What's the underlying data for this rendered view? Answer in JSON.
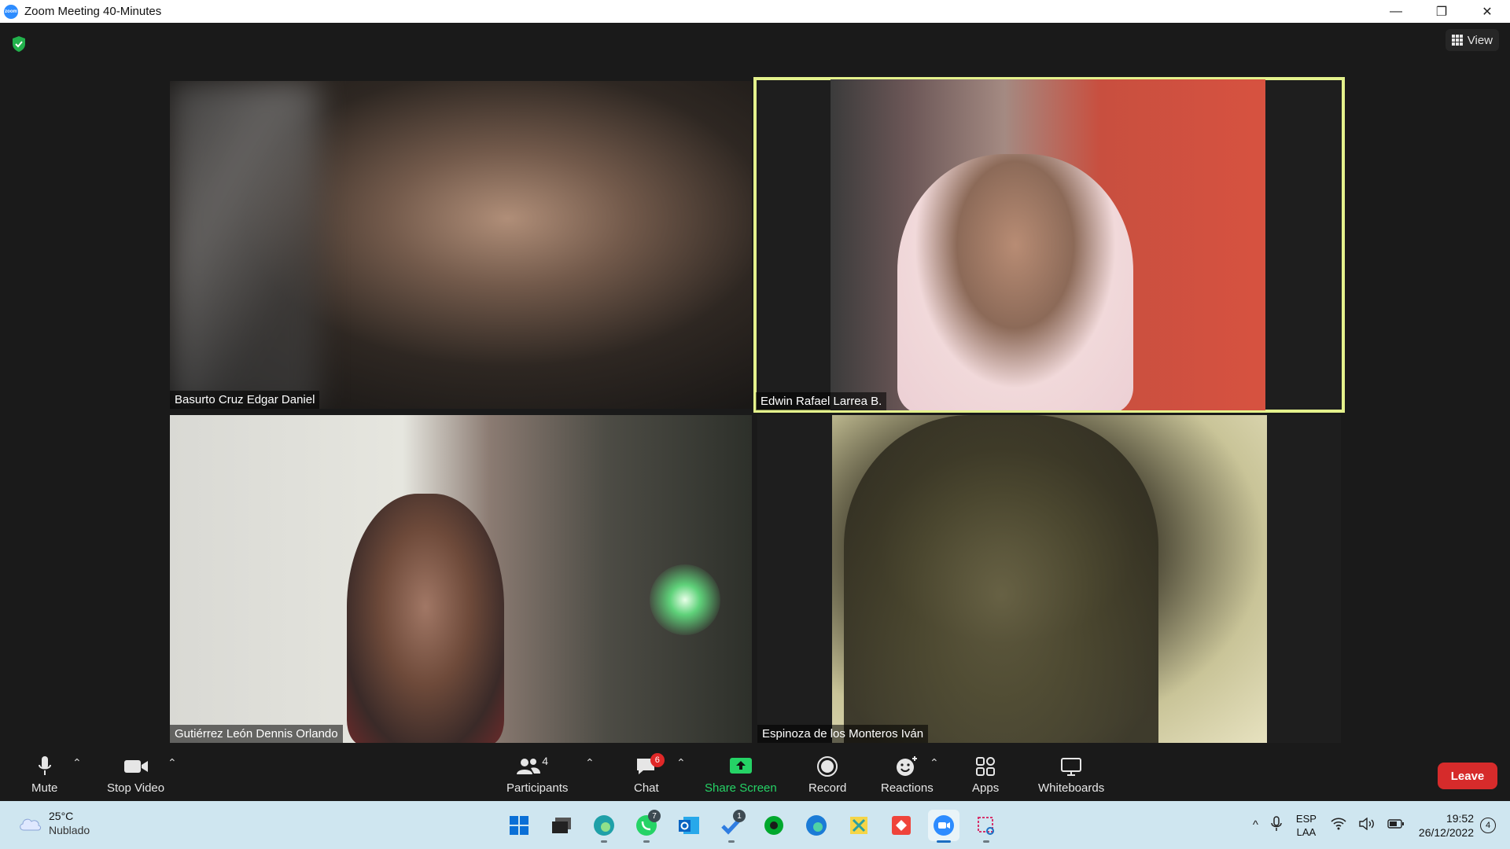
{
  "window": {
    "title": "Zoom Meeting 40-Minutes",
    "app_icon_text": "zoom",
    "minimize_icon": "—",
    "restore_icon": "❐",
    "close_icon": "✕"
  },
  "meeting": {
    "view_label": "View",
    "encryption_icon": "shield-check-icon",
    "participants": [
      {
        "name": "Basurto Cruz Edgar Daniel",
        "active_speaker": false
      },
      {
        "name": "Edwin Rafael Larrea B.",
        "active_speaker": true
      },
      {
        "name": "Gutiérrez León Dennis Orlando",
        "active_speaker": false
      },
      {
        "name": "Espinoza de los Monteros Iván",
        "active_speaker": false
      }
    ],
    "active_speaker_color": "#e4f18c"
  },
  "toolbar": {
    "mute_label": "Mute",
    "stop_video_label": "Stop Video",
    "participants_label": "Participants",
    "participants_count": "4",
    "chat_label": "Chat",
    "chat_badge": "6",
    "share_screen_label": "Share Screen",
    "record_label": "Record",
    "reactions_label": "Reactions",
    "apps_label": "Apps",
    "whiteboards_label": "Whiteboards",
    "leave_label": "Leave",
    "leave_color": "#d62b2b",
    "share_color": "#25d366",
    "caret": "⌃"
  },
  "taskbar": {
    "weather_temp": "25°C",
    "weather_condition": "Nublado",
    "apps": [
      {
        "name": "windows-start-icon",
        "badge": ""
      },
      {
        "name": "task-view-icon",
        "badge": ""
      },
      {
        "name": "edge-browser-icon",
        "badge": ""
      },
      {
        "name": "whatsapp-icon",
        "badge": "7"
      },
      {
        "name": "outlook-icon",
        "badge": ""
      },
      {
        "name": "todo-icon",
        "badge": "1"
      },
      {
        "name": "evernote-icon",
        "badge": ""
      },
      {
        "name": "edge-dev-icon",
        "badge": ""
      },
      {
        "name": "spreadsheet-app-icon",
        "badge": ""
      },
      {
        "name": "anydesk-icon",
        "badge": ""
      },
      {
        "name": "zoom-icon",
        "badge": ""
      },
      {
        "name": "snipping-tool-icon",
        "badge": ""
      }
    ],
    "lang_top": "ESP",
    "lang_bottom": "LAA",
    "time": "19:52",
    "date": "26/12/2022",
    "notifications": "4",
    "tray_chevron": "^"
  }
}
